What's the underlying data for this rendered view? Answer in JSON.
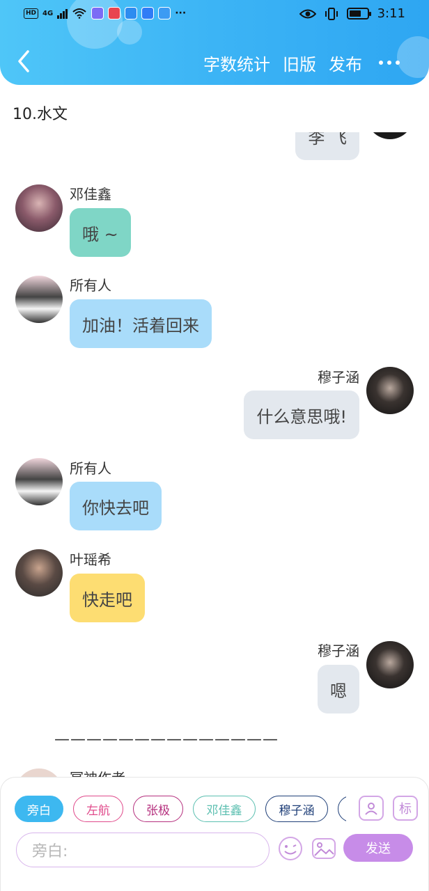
{
  "status_bar": {
    "left_badge": "HD",
    "network": "4G",
    "time": "3:11"
  },
  "nav": {
    "actions": [
      "字数统计",
      "旧版",
      "发布"
    ]
  },
  "chapter": {
    "title": "10.水文"
  },
  "messages": [
    {
      "sender": "",
      "side": "right",
      "text": "李 飞",
      "bubble_color": "#e3e8ee",
      "partial": true
    },
    {
      "sender": "邓佳鑫",
      "side": "left",
      "text": "哦 ~",
      "bubble_color": "#7fd6c6"
    },
    {
      "sender": "所有人",
      "side": "left",
      "text": "加油！活着回来",
      "bubble_color": "#a9dcfa"
    },
    {
      "sender": "穆子涵",
      "side": "right",
      "text": "什么意思哦!",
      "bubble_color": "#e3e8ee"
    },
    {
      "sender": "所有人",
      "side": "left",
      "text": "你快去吧",
      "bubble_color": "#a9dcfa"
    },
    {
      "sender": "叶瑶希",
      "side": "left",
      "text": "快走吧",
      "bubble_color": "#fddd72"
    },
    {
      "sender": "穆子涵",
      "side": "right",
      "text": "嗯",
      "bubble_color": "#e3e8ee"
    }
  ],
  "divider": "——————————————",
  "partial_sender": "冥神作者",
  "composer": {
    "chips": [
      {
        "label": "旁白",
        "color": "#3db8f0",
        "selected": true
      },
      {
        "label": "左航",
        "color": "#e04a8b",
        "selected": false
      },
      {
        "label": "张极",
        "color": "#b5307e",
        "selected": false
      },
      {
        "label": "邓佳鑫",
        "color": "#5bbfb0",
        "selected": false
      },
      {
        "label": "穆子涵",
        "color": "#1f3f78",
        "selected": false
      }
    ],
    "tag_icon_label": "标",
    "input_placeholder": "旁白:",
    "send_label": "发送"
  }
}
